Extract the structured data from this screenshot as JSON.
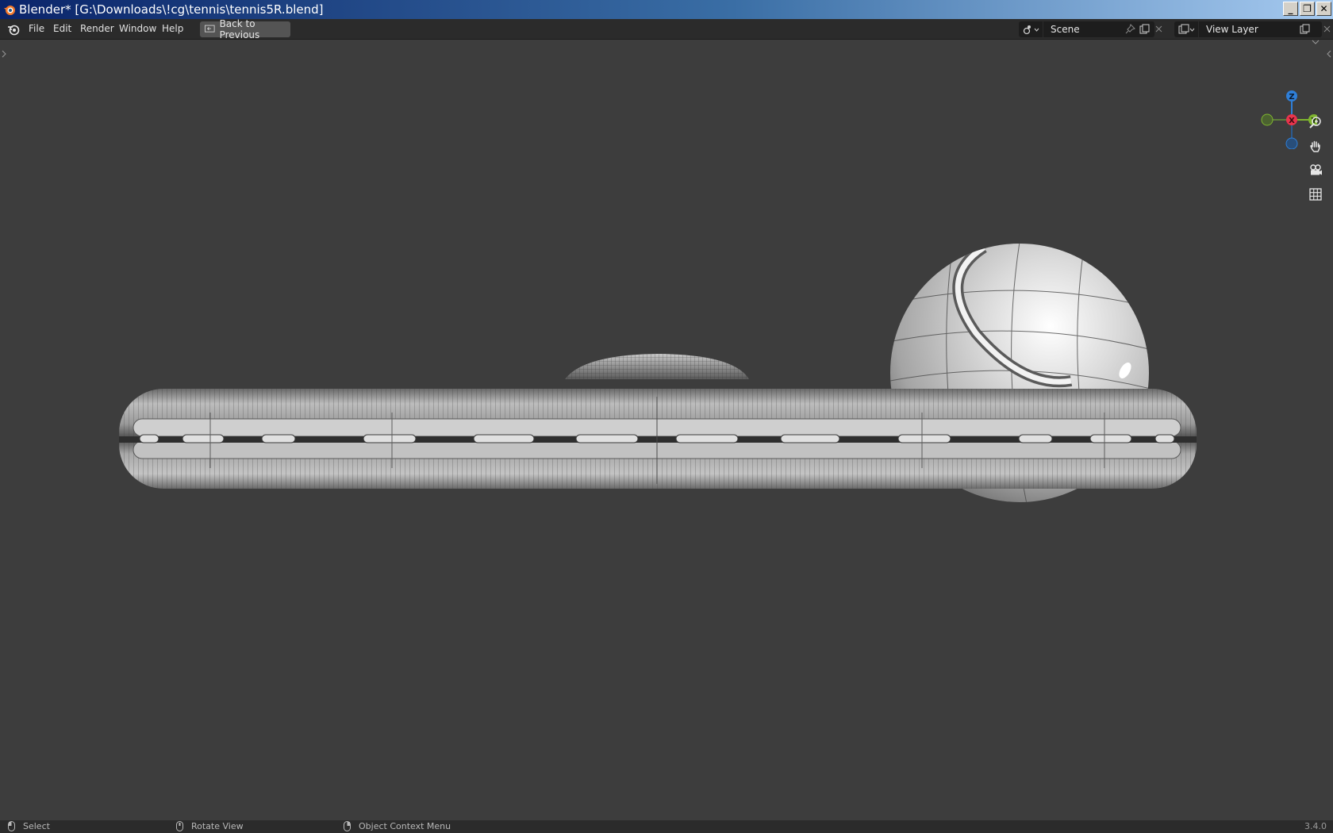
{
  "window": {
    "title": "Blender* [G:\\Downloads\\!cg\\tennis\\tennis5R.blend]",
    "minimize_label": "_",
    "restore_label": "❐",
    "close_label": "✕"
  },
  "menubar": {
    "items": [
      {
        "label": "File"
      },
      {
        "label": "Edit"
      },
      {
        "label": "Render"
      },
      {
        "label": "Window"
      },
      {
        "label": "Help"
      }
    ],
    "back_button_label": "Back to Previous"
  },
  "scene": {
    "name": "Scene"
  },
  "view_layer": {
    "name": "View Layer"
  },
  "gizmo": {
    "z_label": "Z",
    "x_label": "X",
    "y_label": "Y",
    "colors": {
      "x": "#e8344c",
      "y": "#7fb52f",
      "z": "#2f7fd8"
    }
  },
  "statusbar": {
    "select_label": "Select",
    "rotate_label": "Rotate View",
    "context_label": "Object Context Menu",
    "version": "3.4.0"
  }
}
